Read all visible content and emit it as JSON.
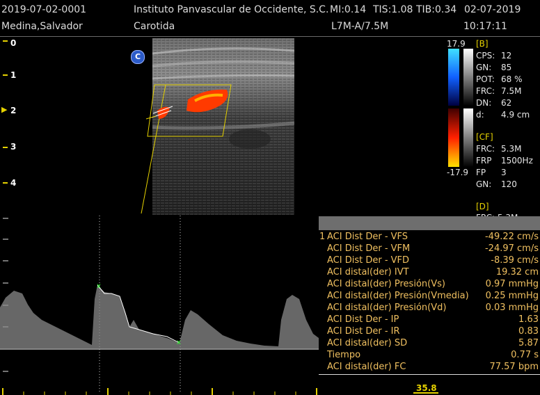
{
  "header": {
    "patient_id": "2019-07-02-0001",
    "patient_name": "Medina,Salvador",
    "institution": "Instituto Panvascular de Occidente, S.C.",
    "mi": "MI:0.14",
    "tis": "TIS:1.08",
    "tib": "TIB:0.34",
    "date": "02-07-2019",
    "exam": "Carotida",
    "probe": "L7M-A/7.5M",
    "time": "10:17:11"
  },
  "depth_scale": [
    "0",
    "1",
    "2",
    "3",
    "4"
  ],
  "active_depth_marker": "2",
  "orientation_marker": "C",
  "colorbar": {
    "max": "17.9",
    "min": "-17.9"
  },
  "b_params": {
    "header": "[B]",
    "rows": [
      {
        "k": "CPS:",
        "v": "12"
      },
      {
        "k": "GN:",
        "v": "85"
      },
      {
        "k": "POT:",
        "v": "68 %"
      },
      {
        "k": "FRC:",
        "v": "7.5M"
      },
      {
        "k": "DN:",
        "v": "62"
      },
      {
        "k": "d:",
        "v": "4.9 cm"
      }
    ]
  },
  "cf_params": {
    "header": "[CF]",
    "rows": [
      {
        "k": "FRC:",
        "v": "5.3M"
      },
      {
        "k": "FRP",
        "v": "1500Hz"
      },
      {
        "k": "FP",
        "v": "3"
      },
      {
        "k": "GN:",
        "v": "120"
      }
    ]
  },
  "d_params": {
    "header": "[D]",
    "partial": "FRC: 5.3M"
  },
  "measurements": [
    {
      "prefix": "1",
      "label": "ACI Dist Der - VFS",
      "value": "-49.22 cm/s"
    },
    {
      "prefix": "",
      "label": "ACI Dist Der - VFM",
      "value": "-24.97 cm/s"
    },
    {
      "prefix": "",
      "label": "ACI Dist Der - VFD",
      "value": "-8.39 cm/s"
    },
    {
      "prefix": "",
      "label": "ACI distal(der) IVT",
      "value": "19.32 cm"
    },
    {
      "prefix": "",
      "label": "ACI distal(der) Presión(Vs)",
      "value": "0.97 mmHg"
    },
    {
      "prefix": "",
      "label": "ACI distal(der) Presión(Vmedia)",
      "value": "0.25 mmHg"
    },
    {
      "prefix": "",
      "label": "ACI distal(der) Presión(Vd)",
      "value": "0.03 mmHg"
    },
    {
      "prefix": "",
      "label": "ACI Dist Der - IP",
      "value": "1.63"
    },
    {
      "prefix": "",
      "label": "ACI Dist Der - IR",
      "value": "0.83"
    },
    {
      "prefix": "",
      "label": "ACI distal(der) SD",
      "value": "5.87"
    },
    {
      "prefix": "",
      "label": "Tiempo",
      "value": "0.77 s"
    },
    {
      "prefix": "",
      "label": "ACI distal(der) FC",
      "value": "77.57 bpm"
    }
  ],
  "time_readout": "35.8",
  "colors": {
    "yellow": "#e6d200",
    "measurement_text": "#f0c060",
    "doppler_red": "#ff3a00",
    "caliper_green": "#2cff2c"
  }
}
